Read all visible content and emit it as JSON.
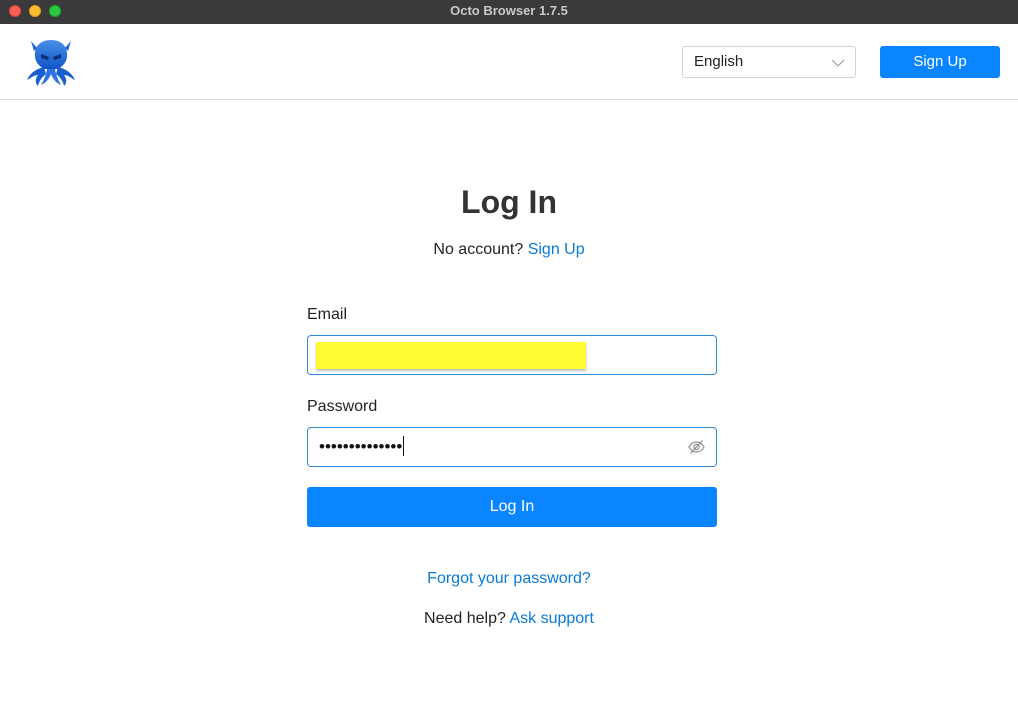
{
  "window": {
    "title": "Octo Browser 1.7.5"
  },
  "header": {
    "logo_icon": "octopus-logo-icon",
    "language": {
      "selected": "English",
      "icon": "chevron-down-icon"
    },
    "signup_label": "Sign Up"
  },
  "login": {
    "title": "Log In",
    "no_account_text": "No account?",
    "signup_link": "Sign Up",
    "email_label": "Email",
    "email_value": "",
    "password_label": "Password",
    "password_masked": "••••••••••••••",
    "password_toggle_icon": "eye-slash-icon",
    "submit_label": "Log In",
    "forgot_link": "Forgot your password?",
    "help_text": "Need help?",
    "support_link": "Ask support"
  },
  "colors": {
    "accent": "#0a84ff",
    "link": "#0a7ad8",
    "titlebar": "#3a3a3c"
  }
}
